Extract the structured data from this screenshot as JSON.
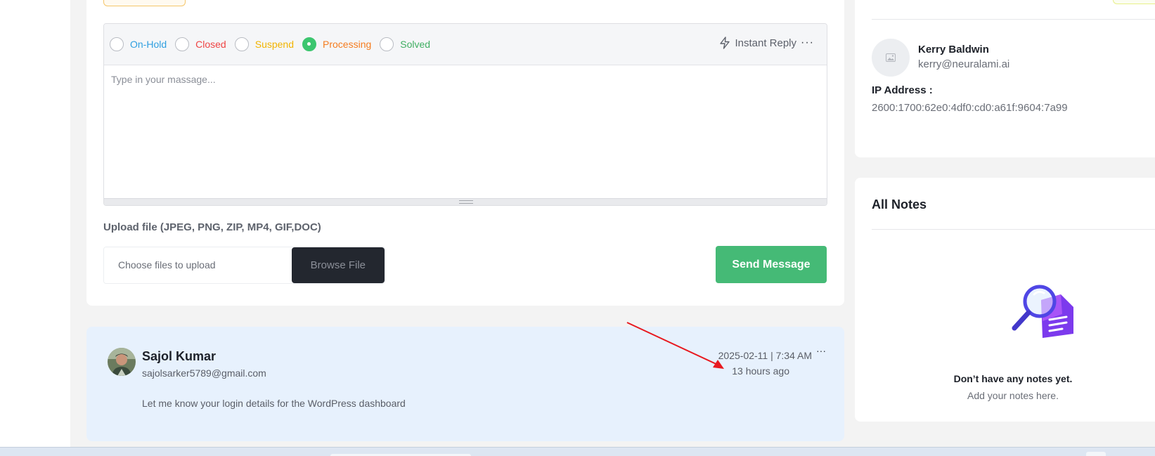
{
  "reply": {
    "statuses": [
      {
        "label": "On-Hold",
        "color": "#2f9fe0",
        "checked": false
      },
      {
        "label": "Closed",
        "color": "#ef4444",
        "checked": false
      },
      {
        "label": "Suspend",
        "color": "#f2b400",
        "checked": false
      },
      {
        "label": "Processing",
        "color": "#f57c1f",
        "checked": true
      },
      {
        "label": "Solved",
        "color": "#3fae62",
        "checked": false
      }
    ],
    "instant_reply_label": "Instant Reply",
    "message_placeholder": "Type in your massage...",
    "upload_title": "Upload file (JPEG, PNG, ZIP, MP4, GIF,DOC)",
    "choose_files_label": "Choose files to upload",
    "browse_button": "Browse File",
    "send_button": "Send Message"
  },
  "comment": {
    "name": "Sajol Kumar",
    "email": "sajolsarker5789@gmail.com",
    "date": "2025-02-11 | 7:34 AM",
    "ago": "13 hours ago",
    "text": "Let me know your login details for the WordPress dashboard"
  },
  "customer": {
    "name": "Kerry Baldwin",
    "email": "kerry@neuralami.ai",
    "ip_label": "IP Address :",
    "ip_value": "2600:1700:62e0:4df0:cd0:a61f:9604:7a99"
  },
  "notes": {
    "title": "All Notes",
    "empty_title": "Don’t have any notes yet.",
    "empty_sub": "Add your notes here."
  },
  "icons": {
    "instant_reply": "lightning-icon",
    "more": "more-dots-icon",
    "avatar_placeholder": "image-icon",
    "notes_empty": "magnifier-document-icon",
    "annotation": "red-arrow"
  }
}
